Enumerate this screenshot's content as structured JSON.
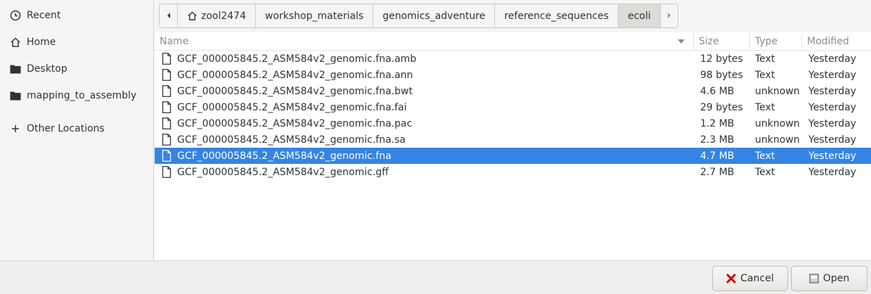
{
  "sidebar": {
    "items": [
      {
        "label": "Recent",
        "icon": "clock-icon"
      },
      {
        "label": "Home",
        "icon": "home-icon"
      },
      {
        "label": "Desktop",
        "icon": "folder-icon"
      },
      {
        "label": "mapping_to_assembly",
        "icon": "folder-icon"
      },
      {
        "label": "Other Locations",
        "icon": "plus-icon"
      }
    ]
  },
  "pathbar": {
    "crumbs": [
      "zool2474",
      "workshop_materials",
      "genomics_adventure",
      "reference_sequences",
      "ecoli"
    ],
    "active_index": 4
  },
  "filelist": {
    "columns": {
      "name": "Name",
      "size": "Size",
      "type": "Type",
      "modified": "Modified"
    },
    "rows": [
      {
        "name": "GCF_000005845.2_ASM584v2_genomic.fna.amb",
        "size": "12 bytes",
        "type": "Text",
        "modified": "Yesterday"
      },
      {
        "name": "GCF_000005845.2_ASM584v2_genomic.fna.ann",
        "size": "98 bytes",
        "type": "Text",
        "modified": "Yesterday"
      },
      {
        "name": "GCF_000005845.2_ASM584v2_genomic.fna.bwt",
        "size": "4.6 MB",
        "type": "unknown",
        "modified": "Yesterday"
      },
      {
        "name": "GCF_000005845.2_ASM584v2_genomic.fna.fai",
        "size": "29 bytes",
        "type": "Text",
        "modified": "Yesterday"
      },
      {
        "name": "GCF_000005845.2_ASM584v2_genomic.fna.pac",
        "size": "1.2 MB",
        "type": "unknown",
        "modified": "Yesterday"
      },
      {
        "name": "GCF_000005845.2_ASM584v2_genomic.fna.sa",
        "size": "2.3 MB",
        "type": "unknown",
        "modified": "Yesterday"
      },
      {
        "name": "GCF_000005845.2_ASM584v2_genomic.fna",
        "size": "4.7 MB",
        "type": "Text",
        "modified": "Yesterday",
        "selected": true
      },
      {
        "name": "GCF_000005845.2_ASM584v2_genomic.gff",
        "size": "2.7 MB",
        "type": "Text",
        "modified": "Yesterday"
      }
    ]
  },
  "buttons": {
    "cancel": "Cancel",
    "open": "Open"
  },
  "colors": {
    "selection": "#3584e4",
    "cancel_icon": "#cc0000"
  }
}
